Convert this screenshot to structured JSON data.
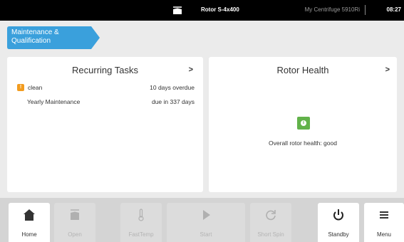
{
  "status_bar": {
    "rotor": "Rotor S-4x400",
    "device": "My Centrifuge 5910Ri",
    "time": "08:27"
  },
  "breadcrumb": {
    "label": "Maintenance & Qualification",
    "color": "#3aa0dc"
  },
  "recurring_tasks": {
    "title": "Recurring Tasks",
    "chevron": ">",
    "items": [
      {
        "icon": "warning-icon",
        "name": "clean",
        "status": "10 days overdue"
      },
      {
        "name": "Yearly Maintenance",
        "status": "due in 337 days"
      }
    ]
  },
  "rotor_health": {
    "title": "Rotor Health",
    "chevron": ">",
    "icon": "info-icon",
    "icon_color": "#62b24a",
    "status_text": "Overall rotor health: good"
  },
  "dock": {
    "buttons": [
      {
        "label": "Home",
        "icon": "home-icon",
        "enabled": true
      },
      {
        "label": "Open",
        "icon": "lid-open-icon",
        "enabled": false
      },
      {
        "label": "FastTemp",
        "icon": "thermometer-icon",
        "enabled": false
      },
      {
        "label": "Start",
        "icon": "play-icon",
        "enabled": false
      },
      {
        "label": "Short Spin",
        "icon": "spin-icon",
        "enabled": false
      },
      {
        "label": "Standby",
        "icon": "power-icon",
        "enabled": true
      },
      {
        "label": "Menu",
        "icon": "menu-icon",
        "enabled": true
      }
    ]
  }
}
